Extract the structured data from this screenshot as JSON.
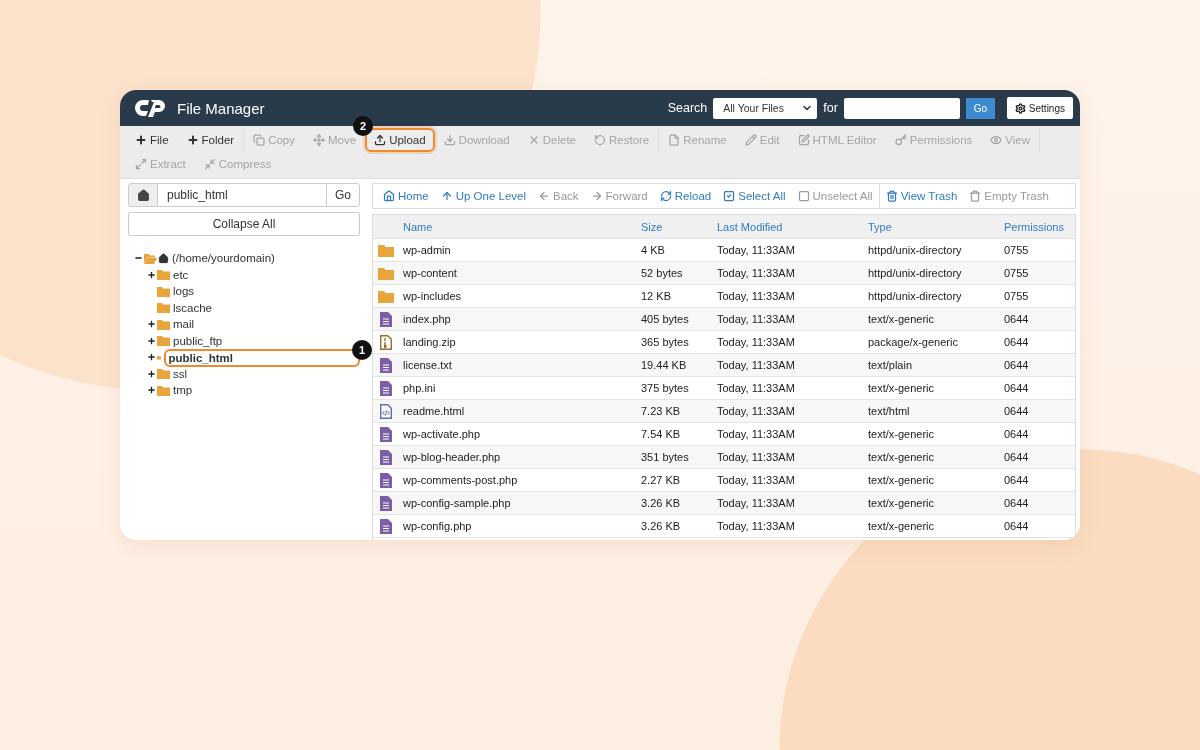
{
  "header": {
    "title": "File Manager",
    "search_label": "Search",
    "search_scope": "All Your Files",
    "for_label": "for",
    "go": "Go",
    "settings": "Settings"
  },
  "toolbar": {
    "groups": [
      [
        {
          "label": "File",
          "disabled": false
        },
        {
          "label": "Folder",
          "disabled": false
        }
      ],
      [
        {
          "label": "Copy",
          "disabled": true
        },
        {
          "label": "Move",
          "disabled": true
        },
        {
          "label": "Upload",
          "disabled": false,
          "badge": "2"
        },
        {
          "label": "Download",
          "disabled": true
        },
        {
          "label": "Delete",
          "disabled": true
        },
        {
          "label": "Restore",
          "disabled": true
        }
      ],
      [
        {
          "label": "Rename",
          "disabled": true
        },
        {
          "label": "Edit",
          "disabled": true
        },
        {
          "label": "HTML Editor",
          "disabled": true
        },
        {
          "label": "Permissions",
          "disabled": true
        },
        {
          "label": "View",
          "disabled": true
        }
      ],
      [
        {
          "label": "Extract",
          "disabled": true
        },
        {
          "label": "Compress",
          "disabled": true
        }
      ]
    ]
  },
  "path_bar": {
    "value": "public_html",
    "go": "Go"
  },
  "collapse_all": "Collapse All",
  "tree": [
    {
      "label": "(/home/yourdomain)",
      "kind": "home",
      "expanded": true,
      "selected": false,
      "children": [
        {
          "label": "etc",
          "kind": "branch",
          "expanded": false,
          "selected": false
        },
        {
          "label": "logs",
          "kind": "leaf",
          "selected": false
        },
        {
          "label": "lscache",
          "kind": "leaf",
          "selected": false
        },
        {
          "label": "mail",
          "kind": "branch",
          "expanded": false,
          "selected": false
        },
        {
          "label": "public_ftp",
          "kind": "branch",
          "expanded": false,
          "selected": false
        },
        {
          "label": "public_html",
          "kind": "branch",
          "expanded": false,
          "selected": true,
          "badge": "1"
        },
        {
          "label": "ssl",
          "kind": "branch",
          "expanded": false,
          "selected": false
        },
        {
          "label": "tmp",
          "kind": "branch",
          "expanded": false,
          "selected": false
        }
      ]
    }
  ],
  "nav": [
    {
      "label": "Home",
      "disabled": false
    },
    {
      "label": "Up One Level",
      "disabled": false
    },
    {
      "label": "Back",
      "disabled": true
    },
    {
      "label": "Forward",
      "disabled": true
    },
    {
      "label": "Reload",
      "disabled": false
    },
    {
      "label": "Select All",
      "disabled": false
    },
    {
      "label": "Unselect All",
      "disabled": true
    },
    {
      "label": "View Trash",
      "disabled": false
    },
    {
      "label": "Empty Trash",
      "disabled": true
    }
  ],
  "table": {
    "columns": [
      "Name",
      "Size",
      "Last Modified",
      "Type",
      "Permissions"
    ],
    "rows": [
      {
        "kind": "folder",
        "name": "wp-admin",
        "size": "4 KB",
        "modified": "Today, 11:33AM",
        "type": "httpd/unix-directory",
        "permissions": "0755"
      },
      {
        "kind": "folder",
        "name": "wp-content",
        "size": "52 bytes",
        "modified": "Today, 11:33AM",
        "type": "httpd/unix-directory",
        "permissions": "0755"
      },
      {
        "kind": "folder",
        "name": "wp-includes",
        "size": "12 KB",
        "modified": "Today, 11:33AM",
        "type": "httpd/unix-directory",
        "permissions": "0755"
      },
      {
        "kind": "text",
        "name": "index.php",
        "size": "405 bytes",
        "modified": "Today, 11:33AM",
        "type": "text/x-generic",
        "permissions": "0644"
      },
      {
        "kind": "zip",
        "name": "landing.zip",
        "size": "365 bytes",
        "modified": "Today, 11:33AM",
        "type": "package/x-generic",
        "permissions": "0644"
      },
      {
        "kind": "text",
        "name": "license.txt",
        "size": "19.44 KB",
        "modified": "Today, 11:33AM",
        "type": "text/plain",
        "permissions": "0644"
      },
      {
        "kind": "text",
        "name": "php.ini",
        "size": "375 bytes",
        "modified": "Today, 11:33AM",
        "type": "text/x-generic",
        "permissions": "0644"
      },
      {
        "kind": "html",
        "name": "readme.html",
        "size": "7.23 KB",
        "modified": "Today, 11:33AM",
        "type": "text/html",
        "permissions": "0644"
      },
      {
        "kind": "text",
        "name": "wp-activate.php",
        "size": "7.54 KB",
        "modified": "Today, 11:33AM",
        "type": "text/x-generic",
        "permissions": "0644"
      },
      {
        "kind": "text",
        "name": "wp-blog-header.php",
        "size": "351 bytes",
        "modified": "Today, 11:33AM",
        "type": "text/x-generic",
        "permissions": "0644"
      },
      {
        "kind": "text",
        "name": "wp-comments-post.php",
        "size": "2.27 KB",
        "modified": "Today, 11:33AM",
        "type": "text/x-generic",
        "permissions": "0644"
      },
      {
        "kind": "text",
        "name": "wp-config-sample.php",
        "size": "3.26 KB",
        "modified": "Today, 11:33AM",
        "type": "text/x-generic",
        "permissions": "0644"
      },
      {
        "kind": "text",
        "name": "wp-config.php",
        "size": "3.26 KB",
        "modified": "Today, 11:33AM",
        "type": "text/x-generic",
        "permissions": "0644"
      }
    ]
  }
}
